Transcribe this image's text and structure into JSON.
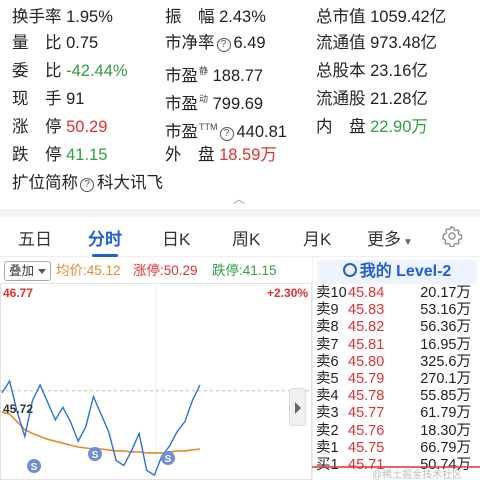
{
  "stats": {
    "rows": [
      [
        {
          "label": "换手率",
          "value": "1.95%",
          "color": "plain"
        },
        {
          "label": "振　幅",
          "value": "2.43%",
          "color": "plain"
        },
        {
          "label": "总市值",
          "value": "1059.42亿",
          "color": "plain"
        }
      ],
      [
        {
          "label": "量　比",
          "value": "0.75",
          "color": "plain"
        },
        {
          "label": "市净率",
          "value": "6.49",
          "color": "plain",
          "info": "?"
        },
        {
          "label": "流通值",
          "value": "973.48亿",
          "color": "plain"
        }
      ],
      [
        {
          "label": "委　比",
          "value": "-42.44%",
          "color": "green"
        },
        {
          "label": "市盈",
          "sup": "静",
          "value": "188.77",
          "color": "plain"
        },
        {
          "label": "总股本",
          "value": "23.16亿",
          "color": "plain"
        }
      ],
      [
        {
          "label": "现　手",
          "value": "91",
          "color": "plain"
        },
        {
          "label": "市盈",
          "sup": "动",
          "value": "799.69",
          "color": "plain"
        },
        {
          "label": "流通股",
          "value": "21.28亿",
          "color": "plain"
        }
      ],
      [
        {
          "label": "涨　停",
          "value": "50.29",
          "color": "red"
        },
        {
          "label": "市盈",
          "sup": "TTM",
          "value": "440.81",
          "color": "plain",
          "info": "?"
        },
        {
          "label": "内　盘",
          "value": "22.90万",
          "color": "green"
        }
      ],
      [
        {
          "label": "跌　停",
          "value": "41.15",
          "color": "green"
        },
        {
          "label": "外　盘",
          "value": "18.59万",
          "color": "red"
        }
      ]
    ],
    "extension_label": "扩位简称",
    "extension_info": "?",
    "extension_value": "科大讯飞"
  },
  "tabs": [
    "五日",
    "分时",
    "日K",
    "周K",
    "月K",
    "更多"
  ],
  "active_tab": "分时",
  "overlay": {
    "button_label": "叠加",
    "avg_label": "均价:45.12",
    "limit_up_label": "涨停:50.29",
    "limit_down_label": "跌停:41.15"
  },
  "chart_data": {
    "type": "line",
    "y_max_label": "46.77",
    "y_max_pct_label": "+2.30%",
    "y_mid_label": "45.72",
    "price_series": [
      45.7,
      45.82,
      45.5,
      45.25,
      45.62,
      45.78,
      45.6,
      45.42,
      45.55,
      45.4,
      45.2,
      45.35,
      45.66,
      45.48,
      45.3,
      45.0,
      44.95,
      45.1,
      45.28,
      44.9,
      44.85,
      45.05,
      45.15,
      45.3,
      45.4,
      45.62,
      45.78
    ],
    "avg_series": [
      45.5,
      45.48,
      45.4,
      45.32,
      45.28,
      45.25,
      45.22,
      45.2,
      45.18,
      45.16,
      45.14,
      45.13,
      45.12,
      45.12,
      45.11,
      45.1,
      45.1,
      45.09,
      45.09,
      45.08,
      45.08,
      45.08,
      45.09,
      45.1,
      45.1,
      45.11,
      45.12
    ],
    "y_range": [
      44.8,
      46.77
    ],
    "colors": {
      "price": "#2b6fe0",
      "avg": "#e8892e"
    }
  },
  "level2": {
    "title": "我的 Level-2",
    "asks": [
      {
        "label": "卖10",
        "price": "45.84",
        "volume": "20.17万"
      },
      {
        "label": "卖9",
        "price": "45.83",
        "volume": "53.16万"
      },
      {
        "label": "卖8",
        "price": "45.82",
        "volume": "56.36万"
      },
      {
        "label": "卖7",
        "price": "45.81",
        "volume": "16.95万"
      },
      {
        "label": "卖6",
        "price": "45.80",
        "volume": "325.6万"
      },
      {
        "label": "卖5",
        "price": "45.79",
        "volume": "270.1万"
      },
      {
        "label": "卖4",
        "price": "45.78",
        "volume": "55.85万"
      },
      {
        "label": "卖3",
        "price": "45.77",
        "volume": "61.79万"
      },
      {
        "label": "卖2",
        "price": "45.76",
        "volume": "18.30万"
      },
      {
        "label": "卖1",
        "price": "45.75",
        "volume": "66.79万"
      }
    ],
    "bids": [
      {
        "label": "买1",
        "price": "45.71",
        "volume": "50.74万"
      }
    ]
  },
  "watermark": "@稀土掘金技术社区"
}
